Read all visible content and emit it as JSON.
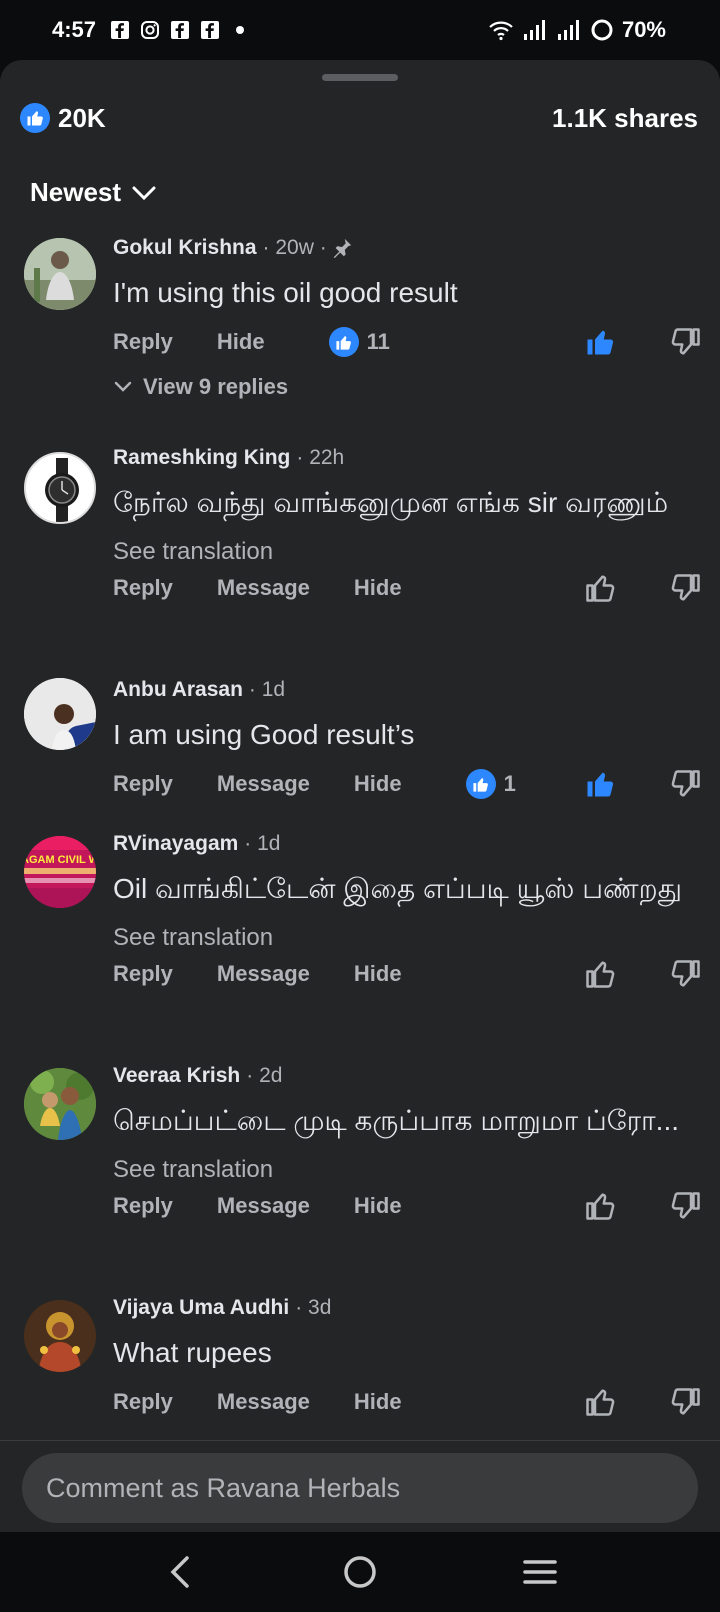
{
  "status_bar": {
    "time": "4:57",
    "battery": "70%",
    "icons": [
      "facebook-icon",
      "instagram-icon",
      "facebook-icon",
      "facebook-icon",
      "dot-icon",
      "wifi-icon",
      "signal-icon",
      "signal-icon",
      "battery-ring-icon"
    ]
  },
  "reactions": {
    "count": "20K",
    "shares": "1.1K shares"
  },
  "sort": {
    "label": "Newest"
  },
  "comments": [
    {
      "name": "Gokul Krishna",
      "meta": "· 20w ·",
      "pinned": true,
      "text": "I'm using this oil good result",
      "see_translation": "",
      "actions": [
        "Reply",
        "Hide"
      ],
      "like_count": "11",
      "liked": true,
      "view_replies": "View 9 replies"
    },
    {
      "name": "Rameshking King",
      "meta": "· 22h",
      "text": "நேர்ல வந்து வாங்கனுமுன எங்க sir வரணும்",
      "see_translation": "See translation",
      "actions": [
        "Reply",
        "Message",
        "Hide"
      ],
      "like_count": "",
      "liked": false
    },
    {
      "name": "Anbu Arasan",
      "meta": "· 1d",
      "text": "I am using Good result’s",
      "see_translation": "",
      "actions": [
        "Reply",
        "Message",
        "Hide"
      ],
      "like_count": "1",
      "liked": true
    },
    {
      "name": "RVinayagam",
      "meta": "· 1d",
      "text": "Oil வாங்கிட்டேன் இதை எப்படி யூஸ் பண்றது",
      "see_translation": "See translation",
      "actions": [
        "Reply",
        "Message",
        "Hide"
      ],
      "like_count": "",
      "liked": false,
      "avatar_text": "AGAM CIVIL W"
    },
    {
      "name": "Veeraa Krish",
      "meta": "· 2d",
      "text": "செமப்பட்டை முடி கருப்பாக மாறுமா ப்ரோ...",
      "see_translation": "See translation",
      "actions": [
        "Reply",
        "Message",
        "Hide"
      ],
      "like_count": "",
      "liked": false
    },
    {
      "name": "Vijaya Uma Audhi",
      "meta": "· 3d",
      "text": "What rupees",
      "see_translation": "",
      "actions": [
        "Reply",
        "Message",
        "Hide"
      ],
      "like_count": "",
      "liked": false
    }
  ],
  "composer": {
    "placeholder": "Comment as Ravana Herbals"
  },
  "colors": {
    "sheet_bg": "#242526",
    "accent": "#2d88ff",
    "text_secondary": "#b0b3b8"
  }
}
